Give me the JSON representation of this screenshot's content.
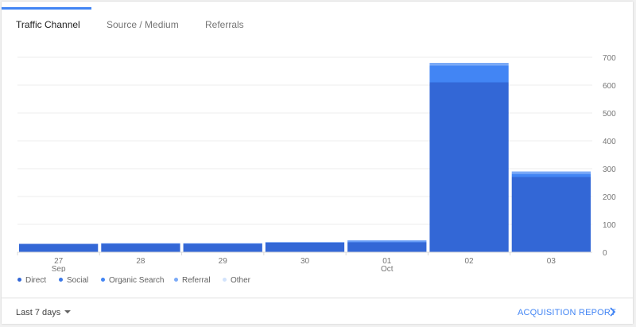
{
  "tabs": [
    {
      "label": "Traffic Channel",
      "active": true
    },
    {
      "label": "Source / Medium",
      "active": false
    },
    {
      "label": "Referrals",
      "active": false
    }
  ],
  "chart_data": {
    "type": "bar",
    "stacked": true,
    "categories": [
      "27",
      "28",
      "29",
      "30",
      "01",
      "02",
      "03"
    ],
    "category_sublabels": [
      "Sep",
      "",
      "",
      "",
      "Oct",
      "",
      ""
    ],
    "series": [
      {
        "name": "Direct",
        "color": "#3367d6",
        "values": [
          30,
          31,
          31,
          35,
          36,
          610,
          270
        ]
      },
      {
        "name": "Social",
        "color": "#3b78e7",
        "values": [
          0,
          0,
          0,
          0,
          0,
          0,
          0
        ]
      },
      {
        "name": "Organic Search",
        "color": "#4285f4",
        "values": [
          0,
          1,
          1,
          1,
          3,
          60,
          12
        ]
      },
      {
        "name": "Referral",
        "color": "#7baaf7",
        "values": [
          0,
          0,
          0,
          0,
          4,
          10,
          8
        ]
      },
      {
        "name": "Other",
        "color": "#c6dafc",
        "values": [
          0,
          0,
          0,
          0,
          0,
          0,
          0
        ]
      }
    ],
    "y_ticks": [
      0,
      100,
      200,
      300,
      400,
      500,
      600,
      700
    ],
    "ylim": [
      0,
      700
    ],
    "y_axis_side": "right",
    "grid": true,
    "legend_position": "bottom"
  },
  "legend": [
    {
      "label": "Direct",
      "color": "#3367d6"
    },
    {
      "label": "Social",
      "color": "#3b78e7"
    },
    {
      "label": "Organic Search",
      "color": "#4285f4"
    },
    {
      "label": "Referral",
      "color": "#7baaf7"
    },
    {
      "label": "Other",
      "color": "#d2e3fc"
    }
  ],
  "footer": {
    "date_range_label": "Last 7 days",
    "report_link_label": "ACQUISITION REPORT"
  }
}
